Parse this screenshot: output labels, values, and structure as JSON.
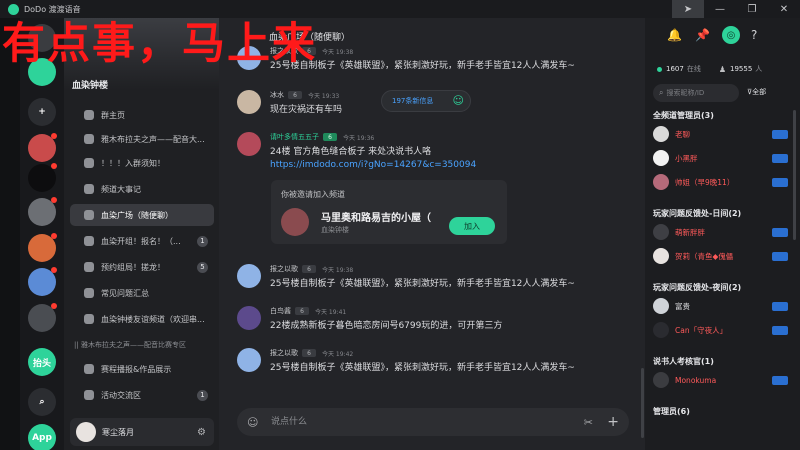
{
  "app": {
    "title": "DoDo 渡渡语音"
  },
  "overlay": {
    "text": "有点事，马上来"
  },
  "rail": {
    "items": [
      {
        "name": "rail-home",
        "color": "#3a3c40",
        "label": ""
      },
      {
        "name": "rail-chat",
        "color": "#2ed39a",
        "label": ""
      },
      {
        "name": "rail-add",
        "color": "#2b2d31",
        "label": "+"
      },
      {
        "name": "rail-server-1",
        "color": "#c94b4b",
        "label": ""
      },
      {
        "name": "rail-server-2",
        "color": "#0d0d0f",
        "label": ""
      },
      {
        "name": "rail-server-3",
        "color": "#6c6f74",
        "label": ""
      },
      {
        "name": "rail-server-4",
        "color": "#d86a3a",
        "label": ""
      },
      {
        "name": "rail-server-5",
        "color": "#5b8bd6",
        "label": ""
      },
      {
        "name": "rail-server-6",
        "color": "#4a4d52",
        "label": ""
      },
      {
        "name": "rail-server-7",
        "color": "#2ed39a",
        "label": "抬头"
      },
      {
        "name": "rail-discover",
        "color": "#2b2d31",
        "label": "⌕"
      },
      {
        "name": "rail-app",
        "color": "#2ed39a",
        "label": "App"
      }
    ]
  },
  "sidebar": {
    "server_name": "血染钟楼",
    "group_label": "|| 雅木布拉夫之声——配音比赛专区",
    "channels": [
      {
        "label": "群主页",
        "badge": ""
      },
      {
        "label": "雅木布拉夫之声——配音大...",
        "badge": ""
      },
      {
        "label": "！！！入群须知！",
        "badge": ""
      },
      {
        "label": "频道大事记",
        "badge": ""
      },
      {
        "label": "血染广场（随便聊）",
        "badge": ""
      },
      {
        "label": "血染开组！报名！（...",
        "badge": "1"
      },
      {
        "label": "预约组局！搓龙！",
        "badge": "5"
      },
      {
        "label": "常见问题汇总",
        "badge": ""
      },
      {
        "label": "血染钟楼友谊频道（欢迎串...",
        "badge": ""
      },
      {
        "label": "赛程播报&作品展示",
        "badge": ""
      },
      {
        "label": "活动交流区",
        "badge": "1"
      }
    ],
    "user": {
      "name": "寒尘落月"
    }
  },
  "chat": {
    "title": "血染广场（随便聊）",
    "new_msg_pill": "197条新信息",
    "messages": [
      {
        "name": "报之以歌",
        "level": "6",
        "time": "今天 19:38",
        "text": "25号楼自制板子《英雄联盟》，紧张刺激好玩，新手老手皆宜12人人满发车~",
        "name_green": false,
        "avatar": "#8fb3e6"
      },
      {
        "name": "冰水",
        "level": "6",
        "time": "今天 19:33",
        "text": "现在灾祸还有车吗",
        "name_green": false,
        "avatar": "#c9b7a3"
      },
      {
        "name": "请叶多情五五子",
        "level": "6",
        "time": "今天 19:36",
        "text": "24楼 官方角色缝合板子 来处决说书人咯",
        "link": "https://imdodo.com/i?gNo=14267&c=350094",
        "name_green": true,
        "avatar": "#b44a5a"
      },
      {
        "name": "报之以歌",
        "level": "6",
        "time": "今天 19:38",
        "text": "25号楼自制板子《英雄联盟》，紧张刺激好玩，新手老手皆宜12人人满发车~",
        "name_green": false,
        "avatar": "#8fb3e6"
      },
      {
        "name": "白鸟酱",
        "level": "6",
        "time": "今天 19:41",
        "text": "22楼成熟新板子暮色暗恋房间号6799玩的进，可开第三方",
        "name_green": false,
        "avatar": "#5c4a8c"
      },
      {
        "name": "报之以歌",
        "level": "6",
        "time": "今天 19:42",
        "text": "25号楼自制板子《英雄联盟》，紧张刺激好玩，新手老手皆宜12人人满发车~",
        "name_green": false,
        "avatar": "#8fb3e6"
      }
    ],
    "invite": {
      "title": "你被邀请加入频道",
      "name": "马里奥和路易吉的小屋（",
      "sub": "血染钟楼",
      "join": "加入"
    },
    "composer": {
      "placeholder": "说点什么"
    }
  },
  "right": {
    "online_count": "1607",
    "online_label": "在线",
    "members_count": "19555",
    "members_label": "人",
    "search_placeholder": "搜索昵称/ID",
    "filter_label": "全部",
    "sections": [
      {
        "title": "全频道管理员(3)",
        "members": [
          {
            "name": "老聊",
            "color": "#ff5a5a",
            "avatar": "#d9d9d9"
          },
          {
            "name": "小黑胖",
            "color": "#ff5a5a",
            "avatar": "#f2f2f2"
          },
          {
            "name": "帅姐（早9晚11）",
            "color": "#ff5a5a",
            "avatar": "#b56a7a"
          }
        ]
      },
      {
        "title": "玩家问题反馈处-日间(2)",
        "members": [
          {
            "name": "萌新胖胖",
            "color": "#ff5a5a",
            "avatar": "#3e3f44"
          },
          {
            "name": "贺莉（青鱼◆傀儡",
            "color": "#ff5a5a",
            "avatar": "#e8e3e0"
          }
        ]
      },
      {
        "title": "玩家问题反馈处-夜间(2)",
        "members": [
          {
            "name": "富贵",
            "color": "#e6e7ea",
            "avatar": "#cfd3d8"
          },
          {
            "name": "Can「守夜人」",
            "color": "#ff5a5a",
            "avatar": "#2a2b30"
          }
        ]
      },
      {
        "title": "说书人考核官(1)",
        "members": [
          {
            "name": "Monokuma",
            "color": "#ff5a5a",
            "avatar": "#3b3c40"
          }
        ]
      },
      {
        "title": "管理员(6)",
        "members": []
      }
    ]
  }
}
